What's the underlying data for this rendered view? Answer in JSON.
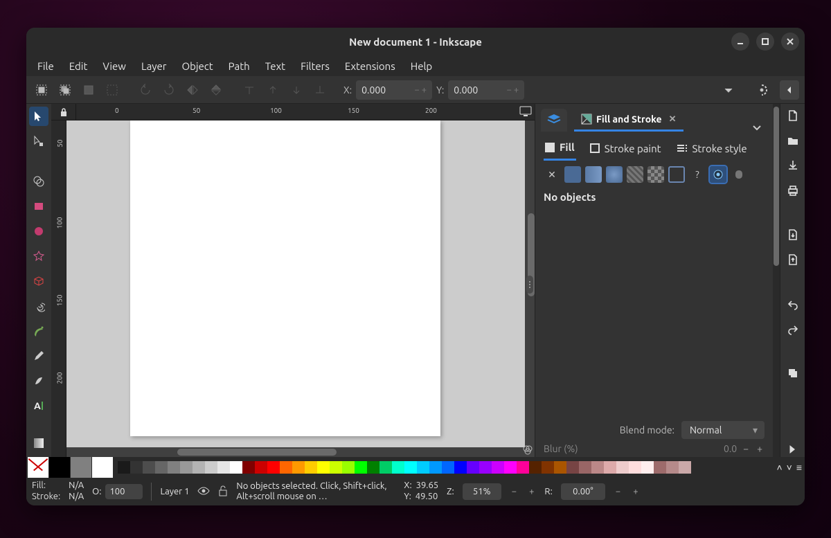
{
  "window": {
    "title": "New document 1 - Inkscape"
  },
  "menu": [
    "File",
    "Edit",
    "View",
    "Layer",
    "Object",
    "Path",
    "Text",
    "Filters",
    "Extensions",
    "Help"
  ],
  "toolbar": {
    "x_label": "X:",
    "x_value": "0.000",
    "y_label": "Y:",
    "y_value": "0.000"
  },
  "ruler_h": [
    "0",
    "50",
    "100",
    "150",
    "200"
  ],
  "ruler_v": [
    "50",
    "100",
    "150",
    "200"
  ],
  "dock": {
    "fill_stroke_tab": "Fill and Stroke",
    "fill_tab": "Fill",
    "stroke_paint_tab": "Stroke paint",
    "stroke_style_tab": "Stroke style",
    "no_objects": "No objects",
    "blend_label": "Blend mode:",
    "blend_value": "Normal",
    "blur_label": "Blur (%)",
    "blur_value": "0.0"
  },
  "palette_main": [
    "#000000",
    "#666666",
    "#ffffff"
  ],
  "palette": [
    "#1a1a1a",
    "#333333",
    "#4d4d4d",
    "#666666",
    "#808080",
    "#999999",
    "#b3b3b3",
    "#cccccc",
    "#e6e6e6",
    "#ffffff",
    "#800000",
    "#cc0000",
    "#ff0000",
    "#ff6600",
    "#ff9900",
    "#ffcc00",
    "#ffff00",
    "#ccff00",
    "#99ff00",
    "#00ff00",
    "#008000",
    "#00cc66",
    "#00ffcc",
    "#00ffff",
    "#00ccff",
    "#0099ff",
    "#0066ff",
    "#0000ff",
    "#6600ff",
    "#9900ff",
    "#cc00ff",
    "#ff00ff",
    "#ff0099",
    "#552200",
    "#803300",
    "#aa5500",
    "#774444",
    "#996666",
    "#bb8888",
    "#ddaaaa",
    "#eecccc",
    "#ffdddd",
    "#ffeeee",
    "#9d6b6b",
    "#b58a8a",
    "#caa8a8"
  ],
  "status": {
    "fill_label": "Fill:",
    "stroke_label": "Stroke:",
    "fill_value": "N/A",
    "stroke_value": "N/A",
    "opacity_label": "O:",
    "opacity_value": "100",
    "layer_name": "Layer 1",
    "message": "No objects selected. Click, Shift+click, Alt+scroll mouse on …",
    "cursor_x_label": "X:",
    "cursor_x": "39.65",
    "cursor_y_label": "Y:",
    "cursor_y": "49.50",
    "zoom_label": "Z:",
    "zoom_value": "51%",
    "rotate_label": "R:",
    "rotate_value": "0.00°"
  }
}
